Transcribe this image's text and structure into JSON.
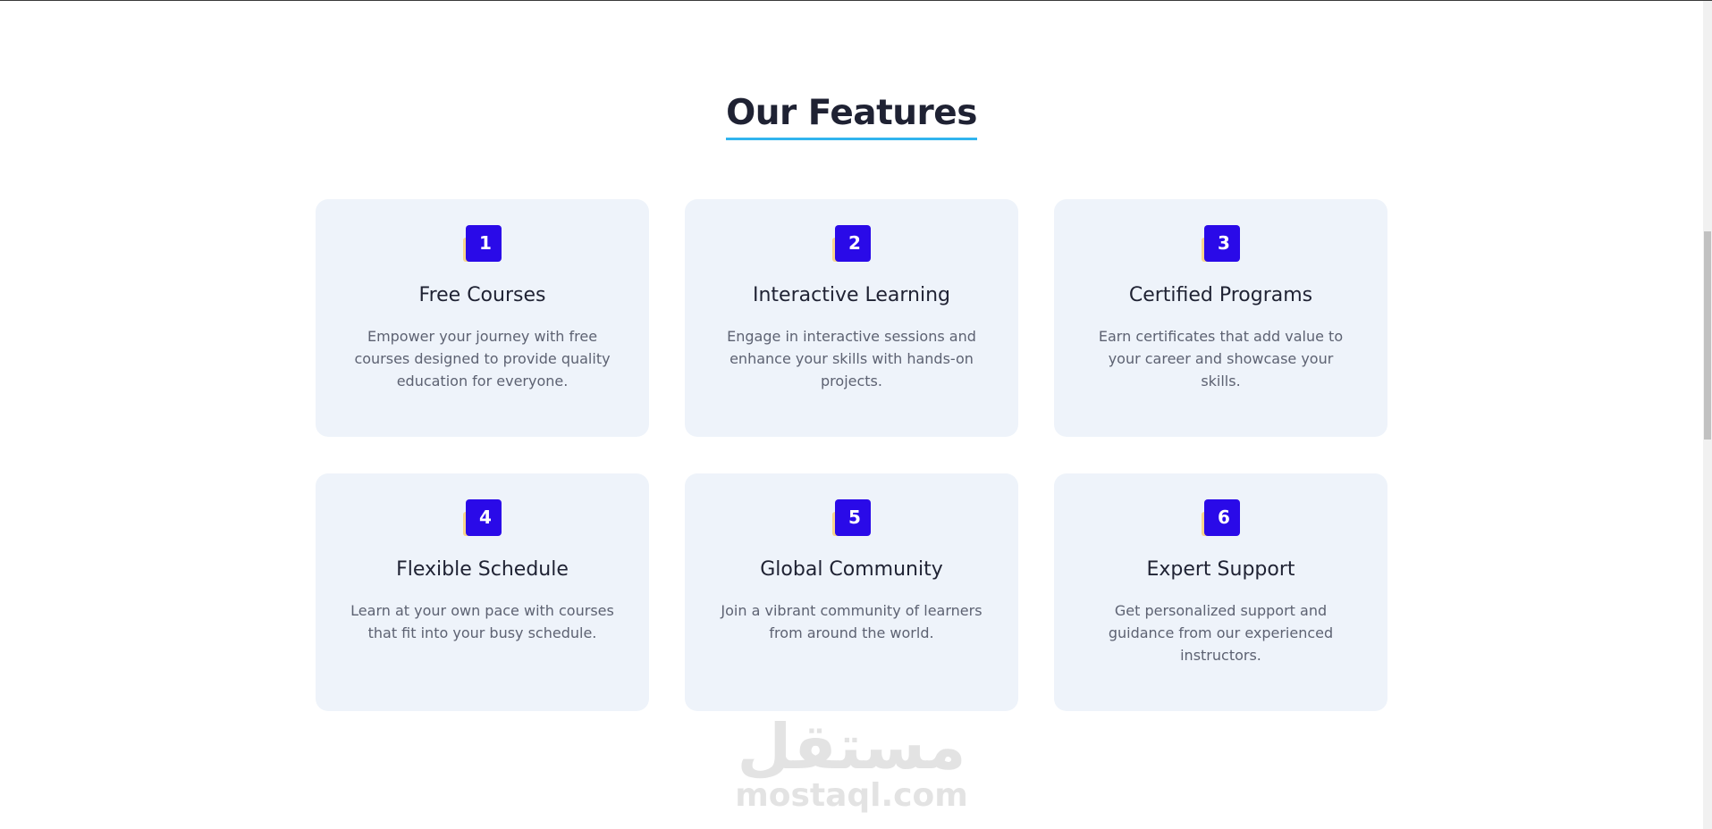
{
  "section": {
    "title": "Our Features",
    "accent_color": "#31b4ee"
  },
  "features": [
    {
      "number": "1",
      "title": "Free Courses",
      "description": "Empower your journey with free courses designed to provide quality education for everyone."
    },
    {
      "number": "2",
      "title": "Interactive Learning",
      "description": "Engage in interactive sessions and enhance your skills with hands-on projects."
    },
    {
      "number": "3",
      "title": "Certified Programs",
      "description": "Earn certificates that add value to your career and showcase your skills."
    },
    {
      "number": "4",
      "title": "Flexible Schedule",
      "description": "Learn at your own pace with courses that fit into your busy schedule."
    },
    {
      "number": "5",
      "title": "Global Community",
      "description": "Join a vibrant community of learners from around the world."
    },
    {
      "number": "6",
      "title": "Expert Support",
      "description": "Get personalized support and guidance from our experienced instructors."
    }
  ],
  "watermark": {
    "arabic": "مستقل",
    "latin": "mostaql.com"
  },
  "colors": {
    "badge": "#2a0ae8",
    "badge_tab": "#f7d58a",
    "card_background": "#eef3fa",
    "heading_text": "#1f2233",
    "body_text": "#5d6272"
  }
}
